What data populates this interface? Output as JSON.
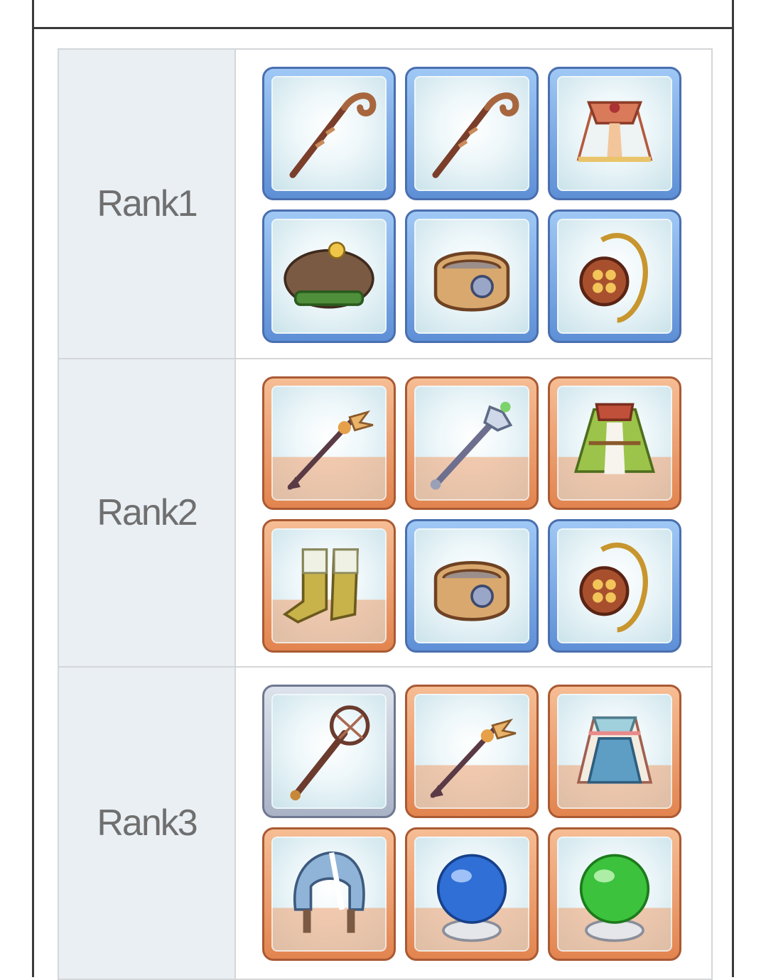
{
  "ranks": [
    {
      "label": "Rank1",
      "items": [
        {
          "icon": "crook-staff-icon",
          "rarity": "blue"
        },
        {
          "icon": "crook-staff-icon",
          "rarity": "blue"
        },
        {
          "icon": "robe-icon",
          "rarity": "blue"
        },
        {
          "icon": "beret-icon",
          "rarity": "blue"
        },
        {
          "icon": "bracelet-icon",
          "rarity": "blue"
        },
        {
          "icon": "amulet-icon",
          "rarity": "blue"
        }
      ]
    },
    {
      "label": "Rank2",
      "items": [
        {
          "icon": "winged-staff-icon",
          "rarity": "orange"
        },
        {
          "icon": "crystal-staff-icon",
          "rarity": "orange"
        },
        {
          "icon": "green-robe-icon",
          "rarity": "orange"
        },
        {
          "icon": "boots-icon",
          "rarity": "orange"
        },
        {
          "icon": "bracelet-icon",
          "rarity": "blue"
        },
        {
          "icon": "amulet-icon",
          "rarity": "blue"
        }
      ]
    },
    {
      "label": "Rank3",
      "items": [
        {
          "icon": "orb-staff-icon",
          "rarity": "silver"
        },
        {
          "icon": "winged-staff-icon",
          "rarity": "orange"
        },
        {
          "icon": "blue-robe-icon",
          "rarity": "orange"
        },
        {
          "icon": "hood-icon",
          "rarity": "orange"
        },
        {
          "icon": "blue-crystal-ball-icon",
          "rarity": "orange"
        },
        {
          "icon": "green-crystal-ball-icon",
          "rarity": "orange"
        }
      ]
    }
  ],
  "colors": {
    "label_bg": "#eaeff4",
    "label_text": "#6f6f6f",
    "frame_border": "#3a3a3a",
    "cell_border": "#d4d6d8",
    "tile_blue": "#5e8fd6",
    "tile_orange": "#e2844f",
    "tile_silver": "#a9b3c6"
  }
}
